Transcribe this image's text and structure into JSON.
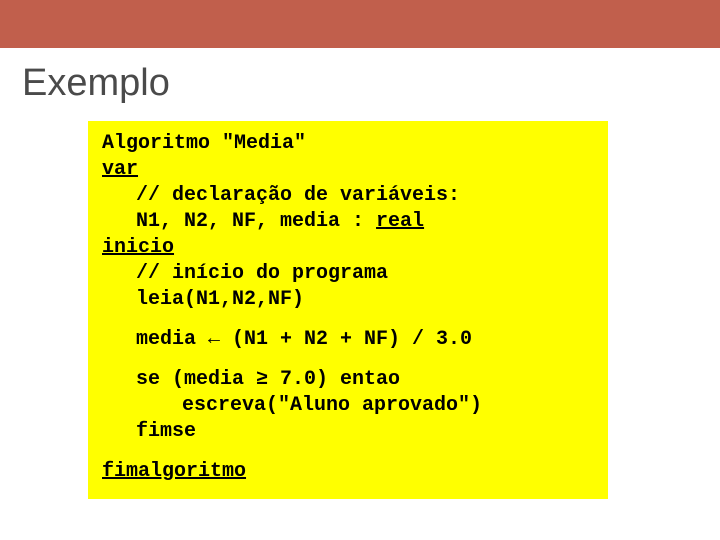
{
  "slide": {
    "title": "Exemplo"
  },
  "code": {
    "l1a": "Algoritmo \"Media\"",
    "l2": "var",
    "l3": "// declaração de variáveis:",
    "l4a": "N1, N2, NF, media : ",
    "l4b": "real",
    "l5": "inicio",
    "l6": "// início do programa",
    "l7": "leia(N1,N2,NF)",
    "l8": "media ← (N1 + N2 + NF) / 3.0",
    "l9": "se (media ≥ 7.0) entao",
    "l10": "escreva(\"Aluno aprovado\")",
    "l11": "fimse",
    "l12": "fimalgoritmo"
  }
}
